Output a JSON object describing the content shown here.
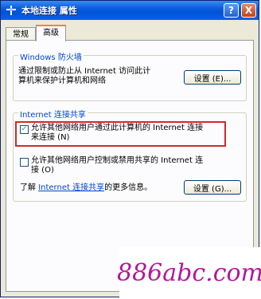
{
  "window": {
    "title": "本地连接 属性",
    "help_label": "?",
    "close_label": "X"
  },
  "tabs": [
    {
      "label": "常规"
    },
    {
      "label": "高级"
    }
  ],
  "firewall": {
    "group_title": "Windows 防火墙",
    "desc_line1": "通过限制或防止从 Internet 访问此计",
    "desc_line2": "算机来保护计算机和网络",
    "settings_button": "设置 (E)..."
  },
  "ics": {
    "group_title": "Internet 连接共享",
    "option1_line1": "允许其他网络用户通过此计算机的 Internet 连接",
    "option1_line2": "来连接 (N)",
    "option1_checked": "✓",
    "option2_line1": "允许其他网络用户控制或禁用共享的 Internet 连",
    "option2_line2": "接 (O)",
    "learn_prefix": "了解",
    "learn_link": "Internet 连接共享",
    "learn_suffix": "的更多信息。",
    "settings_button": "设置 (G)..."
  },
  "watermark": {
    "text": "886abc.com",
    "color": "#b5179a"
  }
}
